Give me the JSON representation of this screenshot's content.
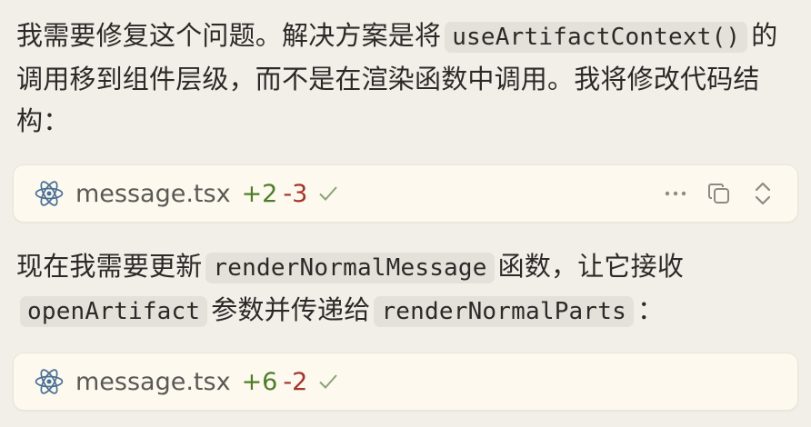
{
  "para1": {
    "before": "我需要修复这个问题。解决方案是将",
    "code": "useArtifactContext()",
    "after": "的调用移到组件层级，而不是在渲染函数中调用。我将修改代码结构："
  },
  "card1": {
    "icon": "react-icon",
    "filename": "message.tsx",
    "added": "+2",
    "removed": "-3"
  },
  "para2": {
    "t1": "现在我需要更新",
    "c1": "renderNormalMessage",
    "t2": "函数，让它接收",
    "c2": "openArtifact",
    "t3": "参数并传递给",
    "c3": "renderNormalParts",
    "t4": "："
  },
  "card2": {
    "icon": "react-icon",
    "filename": "message.tsx",
    "added": "+6",
    "removed": "-2"
  },
  "icons": [
    "react-icon",
    "check-icon",
    "more-icon",
    "copy-icon",
    "expand-icon"
  ],
  "colors": {
    "added": "#4e7d2a",
    "removed": "#a3342a",
    "card_bg": "#fdf9ee",
    "page_bg": "#f2efe8",
    "check": "#8aa377"
  }
}
